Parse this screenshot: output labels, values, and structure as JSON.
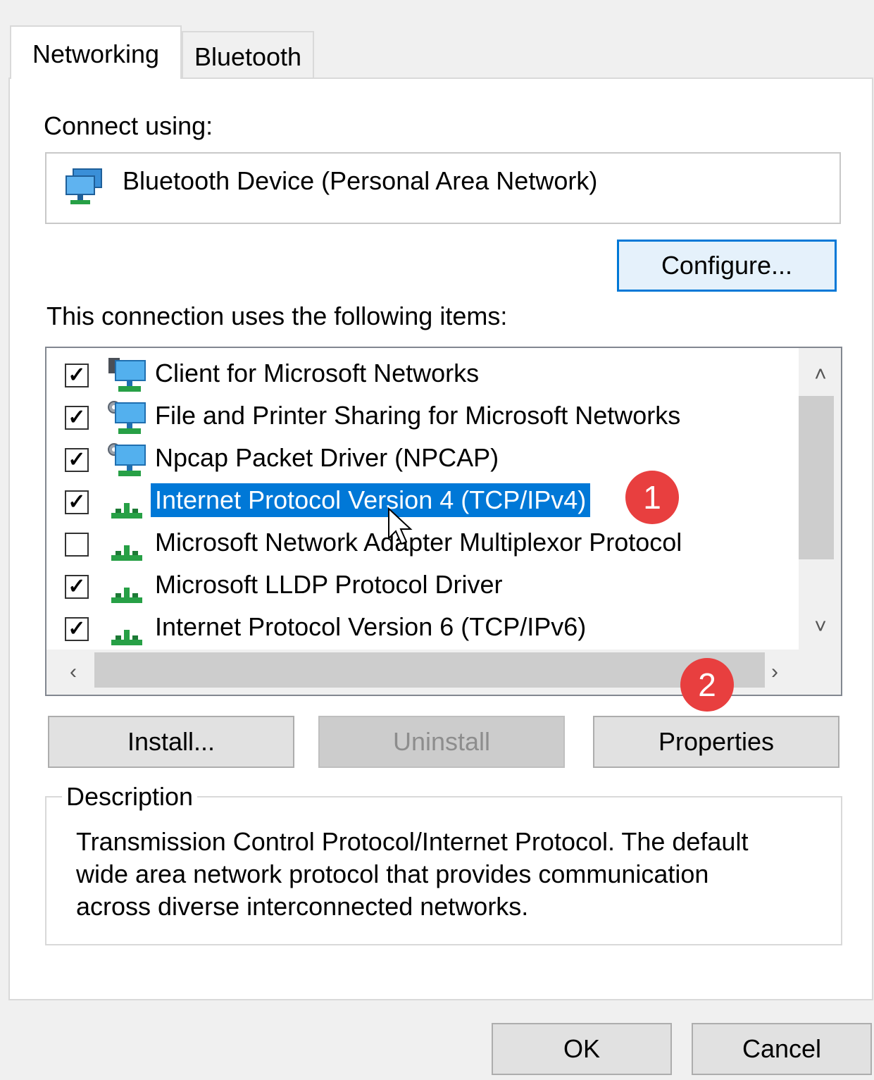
{
  "tabs": [
    "Networking",
    "Bluetooth"
  ],
  "connect_using": {
    "label": "Connect using:",
    "device_icon": "network-adapter-icon",
    "device_name": "Bluetooth Device (Personal Area Network)"
  },
  "configure_label": "Configure...",
  "items_label": "This connection uses the following items:",
  "items": [
    {
      "label": "Client for Microsoft Networks",
      "checked": true,
      "icon": "network-client-icon",
      "selected": false
    },
    {
      "label": "File and Printer Sharing for Microsoft Networks",
      "checked": true,
      "icon": "network-service-icon",
      "selected": false
    },
    {
      "label": "Npcap Packet Driver (NPCAP)",
      "checked": true,
      "icon": "network-service-icon",
      "selected": false
    },
    {
      "label": "Internet Protocol Version 4 (TCP/IPv4)",
      "checked": true,
      "icon": "network-protocol-icon",
      "selected": true
    },
    {
      "label": "Microsoft Network Adapter Multiplexor Protocol",
      "checked": false,
      "icon": "network-protocol-icon",
      "selected": false
    },
    {
      "label": "Microsoft LLDP Protocol Driver",
      "checked": true,
      "icon": "network-protocol-icon",
      "selected": false
    },
    {
      "label": "Internet Protocol Version 6 (TCP/IPv6)",
      "checked": true,
      "icon": "network-protocol-icon",
      "selected": false
    }
  ],
  "scroll_glyphs": {
    "up": "˄",
    "down": "˅",
    "left": "‹",
    "right": "›"
  },
  "buttons": {
    "install": "Install...",
    "uninstall": "Uninstall",
    "properties": "Properties"
  },
  "description": {
    "title": "Description",
    "lines": [
      "Transmission Control Protocol/Internet Protocol. The default",
      "wide area network protocol that provides communication",
      "across diverse interconnected networks."
    ]
  },
  "footer": {
    "ok": "OK",
    "cancel": "Cancel"
  },
  "annotations": [
    "1",
    "2"
  ],
  "colors": {
    "selection": "#0078d7",
    "badge": "#e83f3f",
    "default_button_border": "#0078d7"
  }
}
